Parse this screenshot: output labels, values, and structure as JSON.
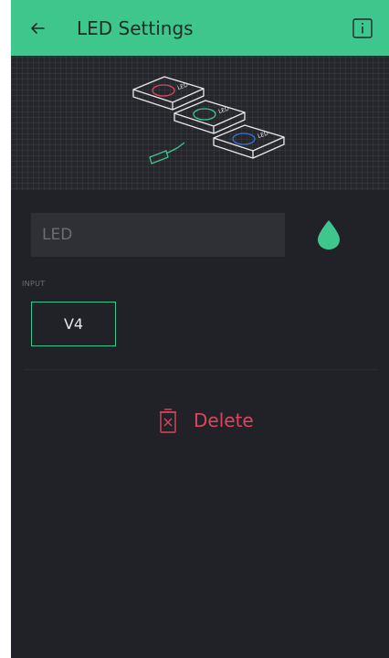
{
  "header": {
    "title": "LED Settings",
    "back_icon": "arrow-left-icon",
    "info_icon": "info-icon",
    "background": "#3ec68d"
  },
  "hero": {
    "illustration": "led-widgets-illustration",
    "label": "LED",
    "led_colors": [
      "#d9465e",
      "#3ec68d",
      "#3b6fd8"
    ]
  },
  "form": {
    "name_placeholder": "LED",
    "color_icon": "drop-icon",
    "color": "#3ec68d",
    "input_label": "INPUT",
    "pin_value": "V4"
  },
  "actions": {
    "delete_label": "Delete",
    "delete_icon": "trash-icon",
    "delete_color": "#d9465e"
  }
}
